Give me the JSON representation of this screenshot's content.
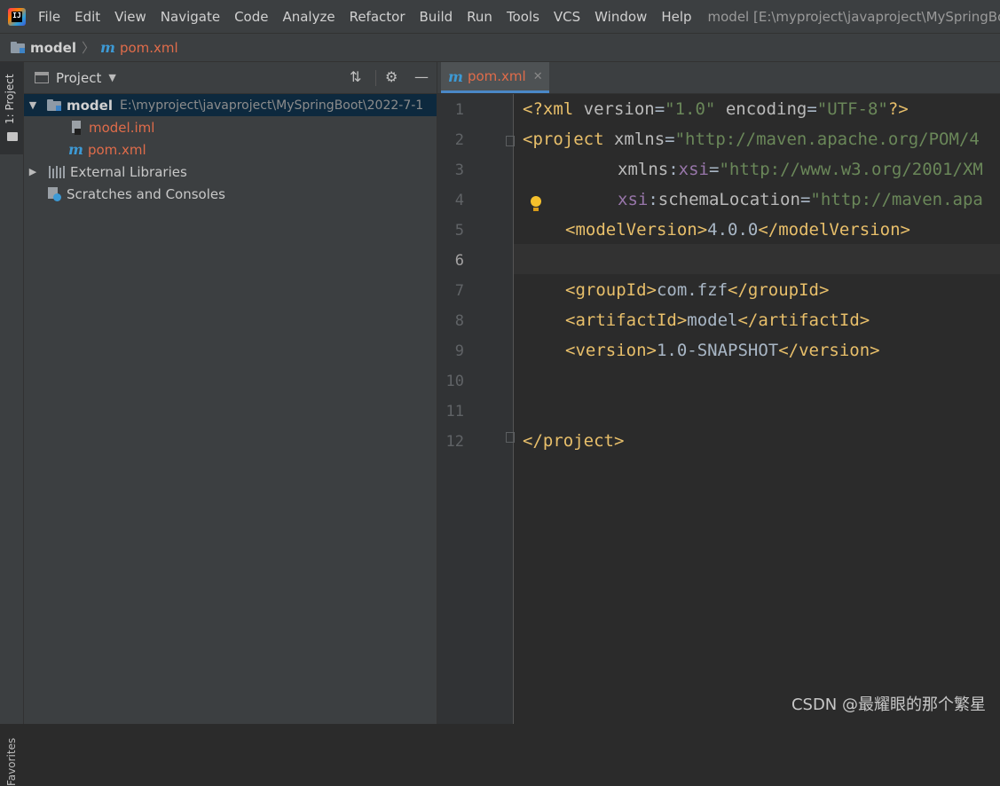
{
  "menubar": {
    "items": [
      "File",
      "Edit",
      "View",
      "Navigate",
      "Code",
      "Analyze",
      "Refactor",
      "Build",
      "Run",
      "Tools",
      "VCS",
      "Window",
      "Help"
    ],
    "title": "model [E:\\myproject\\javaproject\\MySpringBoo"
  },
  "navbar": {
    "project": "model",
    "separator": "〉",
    "file": "pom.xml"
  },
  "toolstrip": {
    "project": "1: Project",
    "favorites": "Favorites"
  },
  "project_panel": {
    "title": "Project",
    "tree": {
      "root_name": "model",
      "root_path": "E:\\myproject\\javaproject\\MySpringBoot\\2022-7-1",
      "files": [
        "model.iml",
        "pom.xml"
      ],
      "external_libraries": "External Libraries",
      "scratches": "Scratches and Consoles"
    }
  },
  "editor": {
    "tab": "pom.xml",
    "current_line": 6,
    "line_numbers": [
      "1",
      "2",
      "3",
      "4",
      "5",
      "6",
      "7",
      "8",
      "9",
      "10",
      "11",
      "12"
    ],
    "code": {
      "l1": [
        "<?xml ",
        "version",
        "=",
        "\"1.0\"",
        " encoding",
        "=",
        "\"UTF-8\"",
        "?>"
      ],
      "l2": [
        "<project ",
        "xmlns",
        "=",
        "\"http://maven.apache.org/POM/4"
      ],
      "l3": [
        "xmlns",
        ":",
        "xsi",
        "=",
        "\"http://www.w3.org/2001/XM"
      ],
      "l4": [
        "xsi",
        ":",
        "schemaLocation",
        "=",
        "\"http://maven.apa"
      ],
      "l5": [
        "<modelVersion>",
        "4.0.0",
        "</modelVersion>"
      ],
      "l7": [
        "<groupId>",
        "com.fzf",
        "</groupId>"
      ],
      "l8": [
        "<artifactId>",
        "model",
        "</artifactId>"
      ],
      "l9": [
        "<version>",
        "1.0-SNAPSHOT",
        "</version>"
      ],
      "l12": [
        "</project>"
      ]
    }
  },
  "watermark": "CSDN @最耀眼的那个繁星",
  "colors": {
    "background": "#2b2b2b",
    "panel": "#3c3f41",
    "selection": "#0d293e",
    "tag": "#e8bf6a",
    "string": "#6a8759",
    "namespace": "#9876aa",
    "file_modified": "#e06c4a"
  }
}
